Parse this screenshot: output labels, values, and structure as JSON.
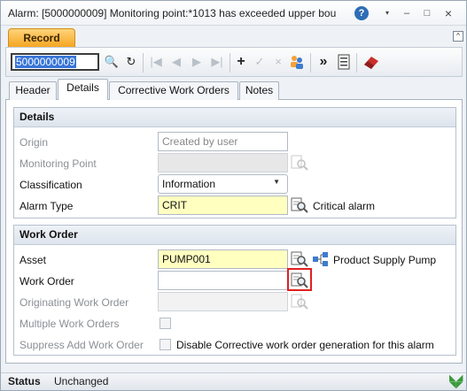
{
  "window": {
    "title": "Alarm: [5000000009] Monitoring point:*1013 has exceeded upper bou",
    "help_glyph": "?",
    "menu_caret_glyph": "▾",
    "minimize_glyph": "–",
    "maximize_glyph": "□",
    "close_glyph": "×"
  },
  "ribbon": {
    "tab_label": "Record",
    "collapse_glyph": "^",
    "record_id": "5000000009",
    "tools": [
      {
        "name": "search-icon",
        "glyph": "🔍"
      },
      {
        "name": "refresh-icon",
        "glyph": "↻"
      },
      {
        "name": "first-record-icon",
        "glyph": "|◀",
        "disabled": true
      },
      {
        "name": "previous-record-icon",
        "glyph": "◀",
        "disabled": true
      },
      {
        "name": "next-record-icon",
        "glyph": "▶",
        "disabled": true
      },
      {
        "name": "last-record-icon",
        "glyph": "▶|",
        "disabled": true
      },
      {
        "name": "add-icon",
        "glyph": "+"
      },
      {
        "name": "save-check-icon",
        "glyph": "✓",
        "disabled": true
      },
      {
        "name": "cancel-x-icon",
        "glyph": "×",
        "disabled": true
      },
      {
        "name": "users-icon",
        "glyph": "👥"
      },
      {
        "name": "more-actions-icon",
        "glyph": "»"
      },
      {
        "name": "list-view-icon",
        "glyph": "☰"
      },
      {
        "name": "eraser-icon",
        "glyph": "✎"
      }
    ]
  },
  "tabs": [
    {
      "label": "Header",
      "active": false
    },
    {
      "label": "Details",
      "active": true
    },
    {
      "label": "Corrective Work Orders",
      "active": false
    },
    {
      "label": "Notes",
      "active": false
    }
  ],
  "details": {
    "heading": "Details",
    "origin_label": "Origin",
    "origin_value": "Created by user",
    "monitoring_point_label": "Monitoring Point",
    "monitoring_point_value": "",
    "classification_label": "Classification",
    "classification_value": "Information",
    "alarm_type_label": "Alarm Type",
    "alarm_type_value": "CRIT",
    "alarm_type_desc": "Critical alarm"
  },
  "work_order": {
    "heading": "Work Order",
    "asset_label": "Asset",
    "asset_value": "PUMP001",
    "asset_desc": "Product Supply Pump",
    "work_order_label": "Work Order",
    "work_order_value": "",
    "originating_label": "Originating Work Order",
    "originating_value": "",
    "multiple_label": "Multiple Work Orders",
    "suppress_label": "Suppress Add Work Order",
    "suppress_desc": "Disable Corrective work order generation for this alarm"
  },
  "status": {
    "label": "Status",
    "value": "Unchanged"
  },
  "colors": {
    "ribbon_tab": "#f5a623",
    "required_field": "#ffffc0",
    "highlight": "#e02020"
  }
}
